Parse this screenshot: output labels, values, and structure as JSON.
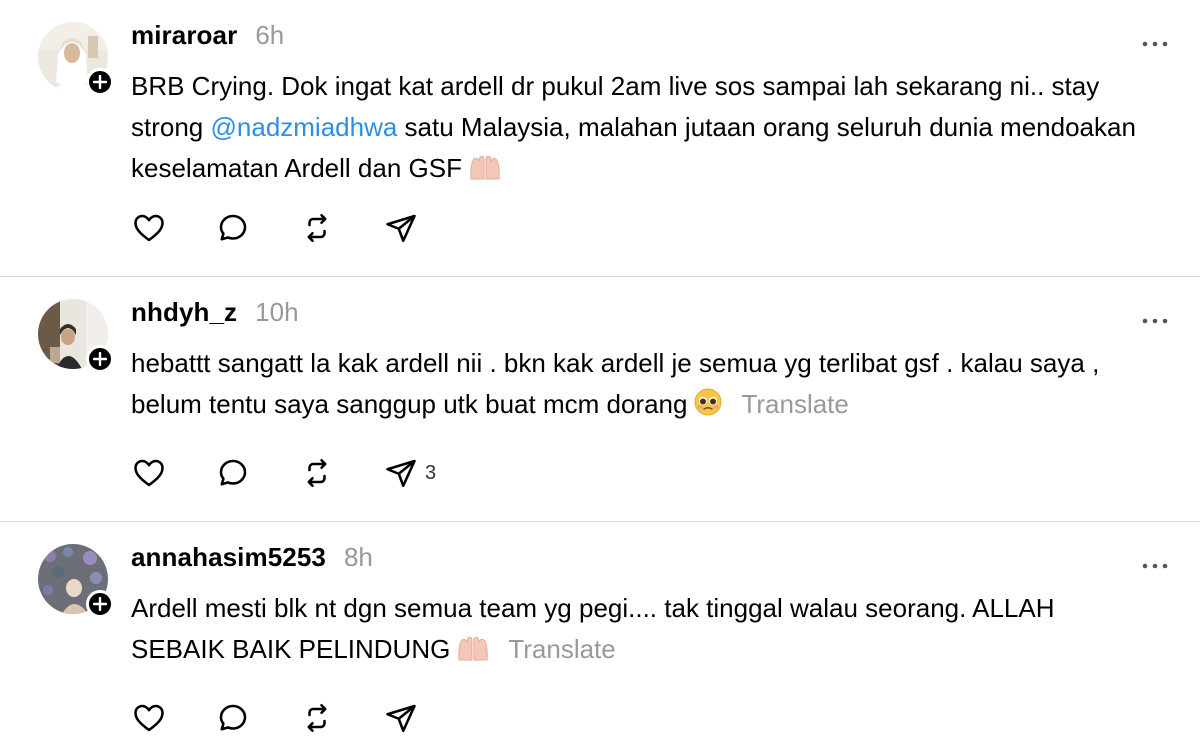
{
  "posts": [
    {
      "username": "miraroar",
      "time": "6h",
      "text_before": "BRB Crying. Dok ingat kat ardell dr pukul 2am live sos sampai lah sekarang ni.. stay strong ",
      "mention": "@nadzmiadhwa",
      "text_after": " satu Malaysia, malahan jutaan orang seluruh dunia mendoakan keselamatan Ardell dan GSF",
      "emoji": "raising-hands-emoji",
      "translate": "",
      "share_count": ""
    },
    {
      "username": "nhdyh_z",
      "time": "10h",
      "text_before": "hebattt sangatt la kak ardell nii . bkn kak ardell je semua yg terlibat gsf . kalau saya , belum tentu saya sanggup utk buat mcm dorang",
      "mention": "",
      "text_after": "",
      "emoji": "pleading-face-emoji",
      "translate": "Translate",
      "share_count": "3"
    },
    {
      "username": "annahasim5253",
      "time": "8h",
      "text_before": "Ardell mesti blk nt dgn semua team yg pegi.... tak tinggal walau seorang. ALLAH SEBAIK BAIK PELINDUNG",
      "mention": "",
      "text_after": "",
      "emoji": "raising-hands-emoji",
      "translate": "Translate",
      "share_count": ""
    }
  ],
  "icons": {
    "like": "heart-icon",
    "reply": "comment-icon",
    "repost": "repost-icon",
    "share": "share-icon",
    "more": "more-icon",
    "follow": "plus-icon"
  },
  "colors": {
    "mention": "#2b8fe8",
    "muted": "#999999",
    "divider": "#d9d9d9"
  }
}
